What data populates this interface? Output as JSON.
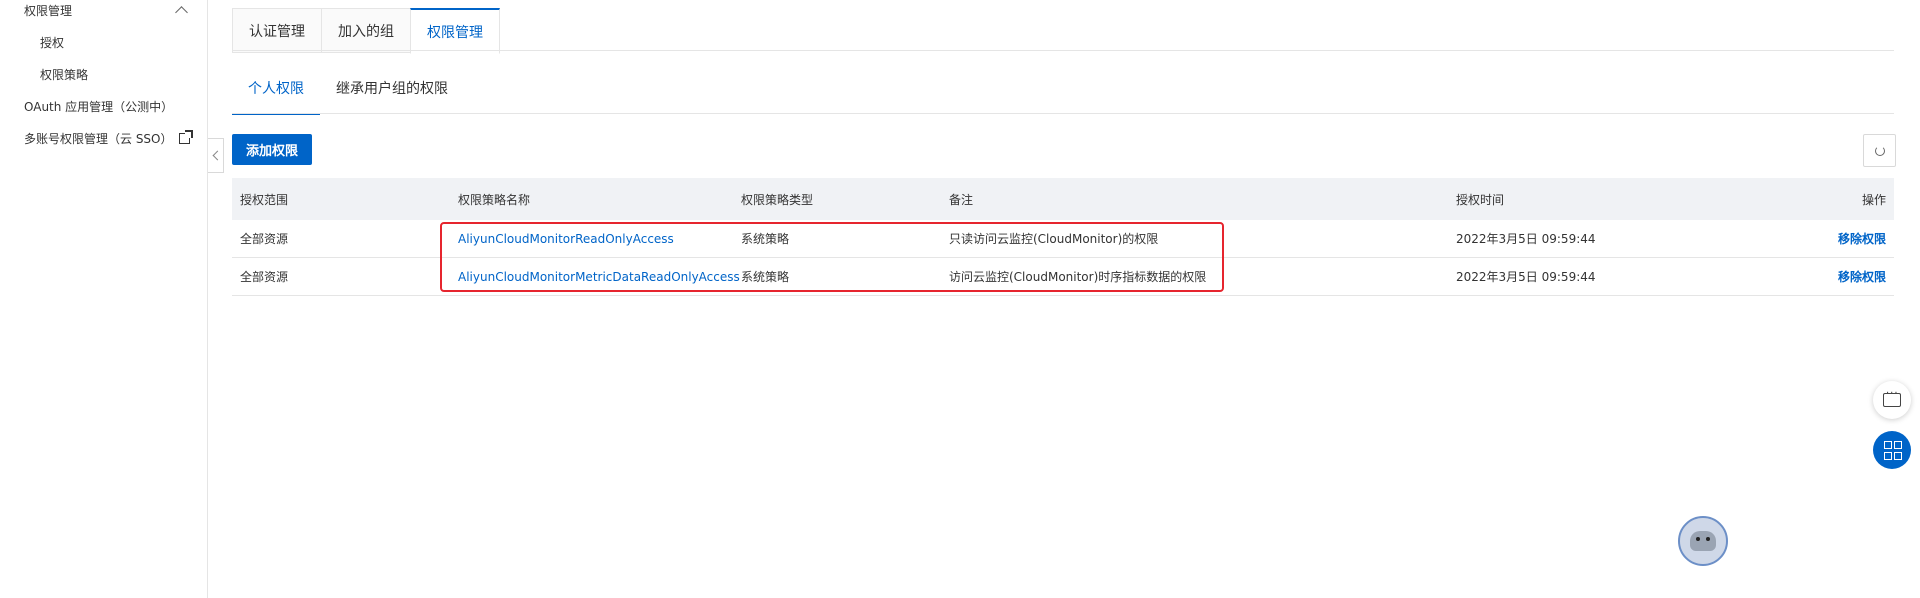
{
  "sidebar": {
    "group_label": "权限管理",
    "items": [
      "授权",
      "权限策略"
    ],
    "oauth_label": "OAuth 应用管理（公测中）",
    "sso_label": "多账号权限管理（云 SSO）"
  },
  "tabs": [
    {
      "label": "认证管理",
      "active": false
    },
    {
      "label": "加入的组",
      "active": false
    },
    {
      "label": "权限管理",
      "active": true
    }
  ],
  "subtabs": [
    {
      "label": "个人权限",
      "active": true
    },
    {
      "label": "继承用户组的权限",
      "active": false
    }
  ],
  "toolbar": {
    "add_label": "添加权限"
  },
  "table": {
    "headers": [
      "授权范围",
      "权限策略名称",
      "权限策略类型",
      "备注",
      "授权时间",
      "操作"
    ],
    "rows": [
      {
        "scope": "全部资源",
        "policy": "AliyunCloudMonitorReadOnlyAccess",
        "type": "系统策略",
        "note": "只读访问云监控(CloudMonitor)的权限",
        "time": "2022年3月5日 09:59:44",
        "action": "移除权限"
      },
      {
        "scope": "全部资源",
        "policy": "AliyunCloudMonitorMetricDataReadOnlyAccess",
        "type": "系统策略",
        "note": "访问云监控(CloudMonitor)时序指标数据的权限",
        "time": "2022年3月5日 09:59:44",
        "action": "移除权限"
      }
    ]
  },
  "colors": {
    "accent": "#0064c8",
    "highlight": "#e6252e"
  },
  "icons": [
    "chevron-up-icon",
    "external-link-icon",
    "chevron-left-icon",
    "refresh-icon",
    "chat-icon",
    "apps-icon",
    "robot-assistant-icon"
  ]
}
